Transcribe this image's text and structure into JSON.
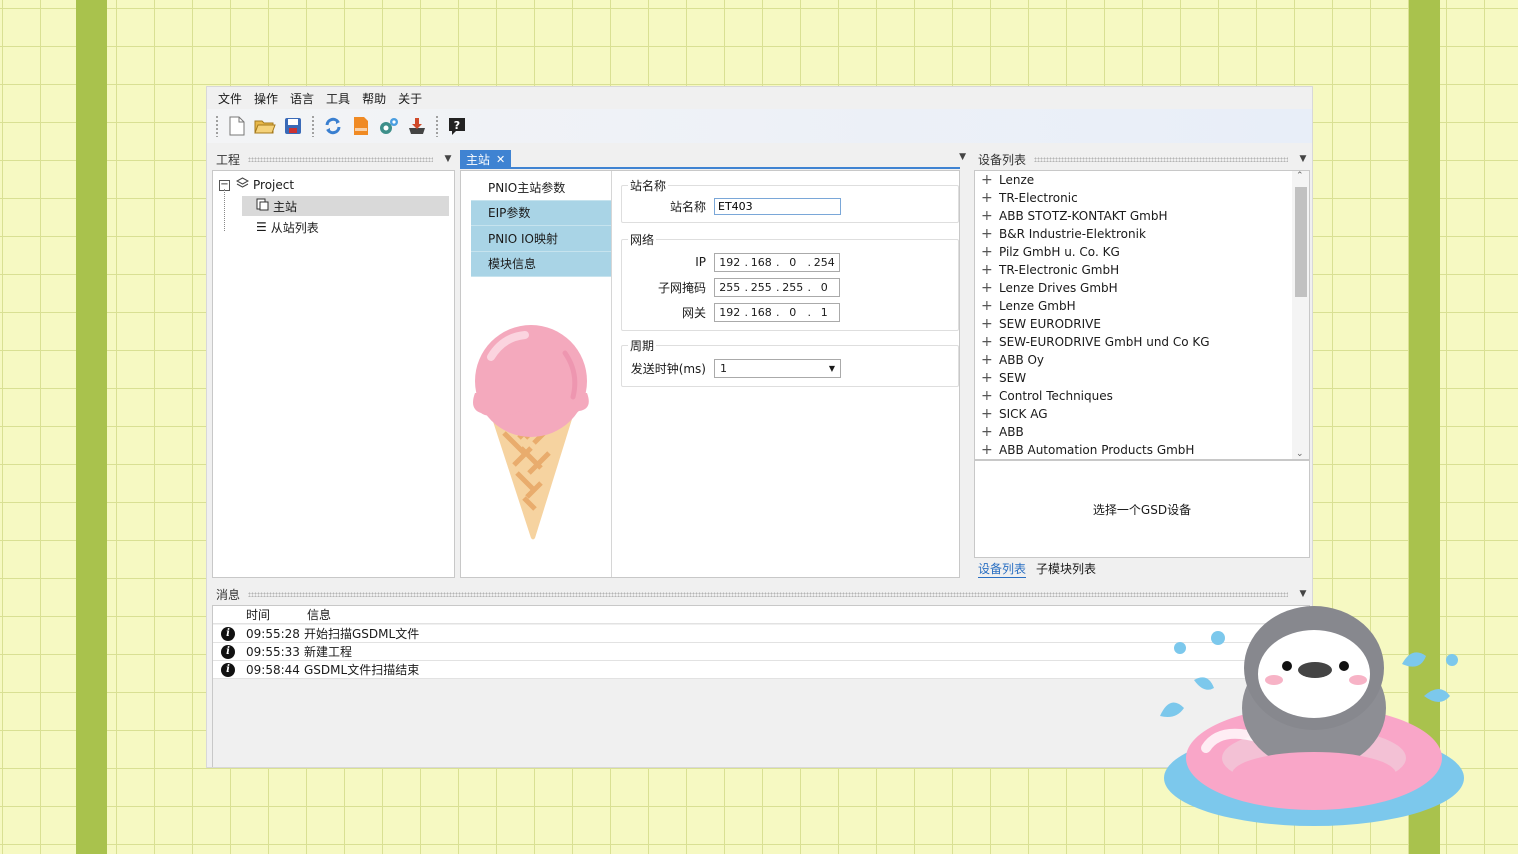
{
  "menu": [
    "文件",
    "操作",
    "语言",
    "工具",
    "帮助",
    "关于"
  ],
  "toolbar_icons": [
    "new-file-icon",
    "open-folder-icon",
    "save-icon",
    "refresh-icon",
    "gsdml-file-icon",
    "settings-gears-icon",
    "download-icon",
    "help-icon"
  ],
  "project_panel": {
    "title": "工程",
    "tree": {
      "root": "Project",
      "master": "主站",
      "slave_list": "从站列表"
    }
  },
  "center": {
    "tab_label": "主站",
    "tab_close": "✕",
    "side_tabs": [
      "PNIO主站参数",
      "EIP参数",
      "PNIO IO映射",
      "模块信息"
    ],
    "station_group": {
      "title": "站名称",
      "label": "站名称",
      "value": "ET403"
    },
    "network_group": {
      "title": "网络",
      "ip_label": "IP",
      "ip": [
        "192",
        "168",
        "0",
        "254"
      ],
      "mask_label": "子网掩码",
      "mask": [
        "255",
        "255",
        "255",
        "0"
      ],
      "gateway_label": "网关",
      "gateway": [
        "192",
        "168",
        "0",
        "1"
      ]
    },
    "cycle_group": {
      "title": "周期",
      "label": "发送时钟(ms)",
      "value": "1"
    }
  },
  "device_panel": {
    "title": "设备列表",
    "items": [
      "Lenze",
      "TR-Electronic",
      "ABB STOTZ-KONTAKT GmbH",
      "B&R Industrie-Elektronik",
      "Pilz GmbH u. Co. KG",
      "TR-Electronic GmbH",
      "Lenze Drives GmbH",
      "Lenze GmbH",
      "SEW EURODRIVE",
      "SEW-EURODRIVE GmbH und Co KG",
      "ABB Oy",
      "SEW",
      "Control Techniques",
      "SICK AG",
      "ABB",
      "ABB Automation Products GmbH"
    ],
    "placeholder": "选择一个GSD设备",
    "tabs": [
      "设备列表",
      "子模块列表"
    ]
  },
  "messages": {
    "title": "消息",
    "columns": [
      "时间",
      "信息"
    ],
    "rows": [
      {
        "time": "09:55:28",
        "text": "开始扫描GSDML文件"
      },
      {
        "time": "09:55:33",
        "text": "新建工程"
      },
      {
        "time": "09:58:44",
        "text": "GSDML文件扫描结束"
      }
    ]
  },
  "colors": {
    "background": "#f6f9c2",
    "stripe": "#a9c24d",
    "tab_accent": "#3f83d2",
    "side_tab": "#a9d4e6"
  }
}
